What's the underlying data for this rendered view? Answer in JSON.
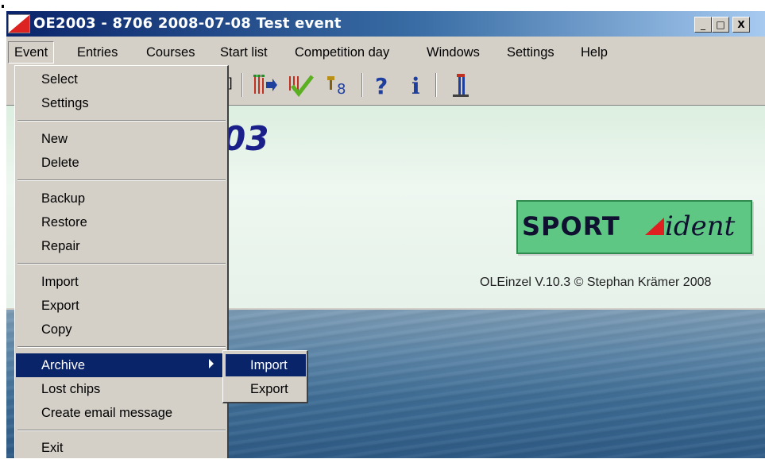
{
  "window": {
    "title": "OE2003  -  8706 2008-07-08 Test event",
    "controls": {
      "minimize": "_",
      "maximize": "□",
      "close": "X"
    }
  },
  "menubar": {
    "items": [
      "Event",
      "Entries",
      "Courses",
      "Start list",
      "Competition day",
      "Windows",
      "Settings",
      "Help"
    ]
  },
  "toolbar": {
    "icons": [
      "list-arrow-icon",
      "checkmark-icon",
      "trophy-icon",
      "help-icon",
      "info-icon",
      "tower-icon"
    ],
    "help_glyph": "?",
    "info_glyph": "i"
  },
  "main": {
    "app_title_fragment": "03",
    "logo": {
      "sport": "SPORT",
      "ident": "ident"
    },
    "version": "OLEinzel V.10.3 © Stephan Krämer 2008"
  },
  "event_menu": {
    "groups": [
      [
        "Select",
        "Settings"
      ],
      [
        "New",
        "Delete"
      ],
      [
        "Backup",
        "Restore",
        "Repair"
      ],
      [
        "Import",
        "Export",
        "Copy"
      ],
      [
        "Archive",
        "Lost chips",
        "Create email message"
      ],
      [
        "Exit"
      ]
    ],
    "highlighted": "Archive"
  },
  "archive_submenu": {
    "items": [
      "Import",
      "Export"
    ],
    "highlighted": "Import"
  },
  "colors": {
    "menu_highlight": "#0a246a",
    "title_gradient_start": "#0a246a",
    "logo_green": "#5fc784"
  }
}
